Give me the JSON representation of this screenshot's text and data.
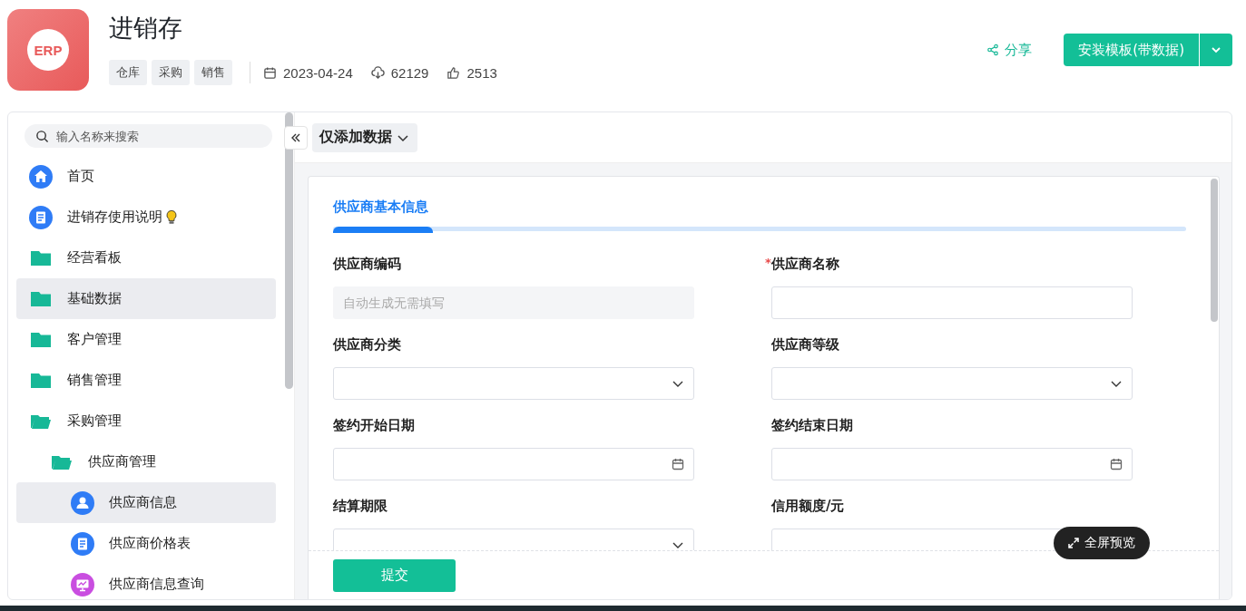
{
  "app": {
    "title": "进销存",
    "logo_text": "ERP",
    "tags": [
      "仓库",
      "采购",
      "销售"
    ],
    "date": "2023-04-24",
    "downloads": "62129",
    "likes": "2513"
  },
  "actions": {
    "share": "分享",
    "install": "安装模板(带数据)"
  },
  "sidebar": {
    "search_placeholder": "输入名称来搜索",
    "items": [
      {
        "label": "首页",
        "kind": "home",
        "selected": false
      },
      {
        "label": "进销存使用说明",
        "kind": "doc",
        "selected": false,
        "bulb": true
      },
      {
        "label": "经营看板",
        "kind": "folder",
        "selected": false
      },
      {
        "label": "基础数据",
        "kind": "folder",
        "selected": true
      },
      {
        "label": "客户管理",
        "kind": "folder",
        "selected": false
      },
      {
        "label": "销售管理",
        "kind": "folder",
        "selected": false
      },
      {
        "label": "采购管理",
        "kind": "folder",
        "selected": false,
        "expanded": true,
        "children": [
          {
            "label": "供应商管理",
            "kind": "folder",
            "selected": false,
            "expanded": true,
            "children": [
              {
                "label": "供应商信息",
                "kind": "user",
                "selected": true
              },
              {
                "label": "供应商价格表",
                "kind": "doc",
                "selected": false
              },
              {
                "label": "供应商信息查询",
                "kind": "chart",
                "selected": false
              }
            ]
          }
        ]
      }
    ]
  },
  "toolbar": {
    "mode": "仅添加数据"
  },
  "form": {
    "tab": "供应商基本信息",
    "required_mark": "*",
    "fields": [
      {
        "label": "供应商编码",
        "kind": "text",
        "disabled": true,
        "placeholder": "自动生成无需填写",
        "required": false
      },
      {
        "label": "供应商名称",
        "kind": "text",
        "disabled": false,
        "required": true
      },
      {
        "label": "供应商分类",
        "kind": "select",
        "required": false
      },
      {
        "label": "供应商等级",
        "kind": "select",
        "required": false
      },
      {
        "label": "签约开始日期",
        "kind": "date",
        "required": false
      },
      {
        "label": "签约结束日期",
        "kind": "date",
        "required": false
      },
      {
        "label": "结算期限",
        "kind": "select",
        "required": false
      },
      {
        "label": "信用额度/元",
        "kind": "text",
        "disabled": false,
        "required": false
      }
    ],
    "submit": "提交",
    "fullscreen": "全屏预览"
  }
}
